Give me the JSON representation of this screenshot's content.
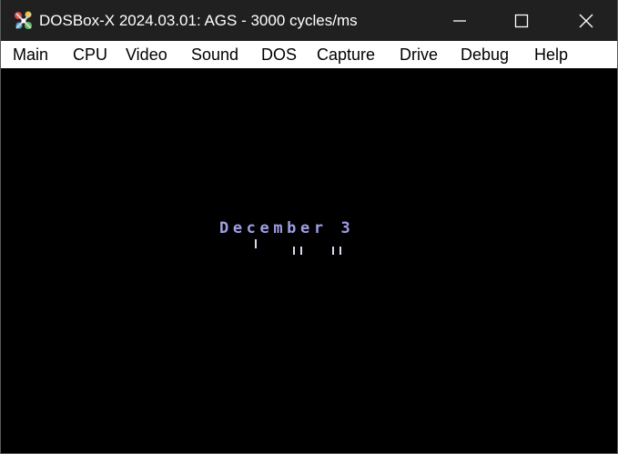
{
  "window": {
    "title": "DOSBox-X 2024.03.01: AGS - 3000 cycles/ms",
    "icon": "dosbox-x-app-icon",
    "controls": {
      "minimize": "minimize-icon",
      "maximize": "maximize-icon",
      "close": "close-icon"
    }
  },
  "menubar": {
    "items": [
      "Main",
      "CPU",
      "Video",
      "Sound",
      "DOS",
      "Capture",
      "Drive",
      "Debug",
      "Help"
    ]
  },
  "screen": {
    "text": "December 3"
  },
  "colors": {
    "titlebar": "#202020",
    "menubar": "#ffffff",
    "screen_bg": "#000000",
    "screen_text": "#9f9fe3"
  }
}
